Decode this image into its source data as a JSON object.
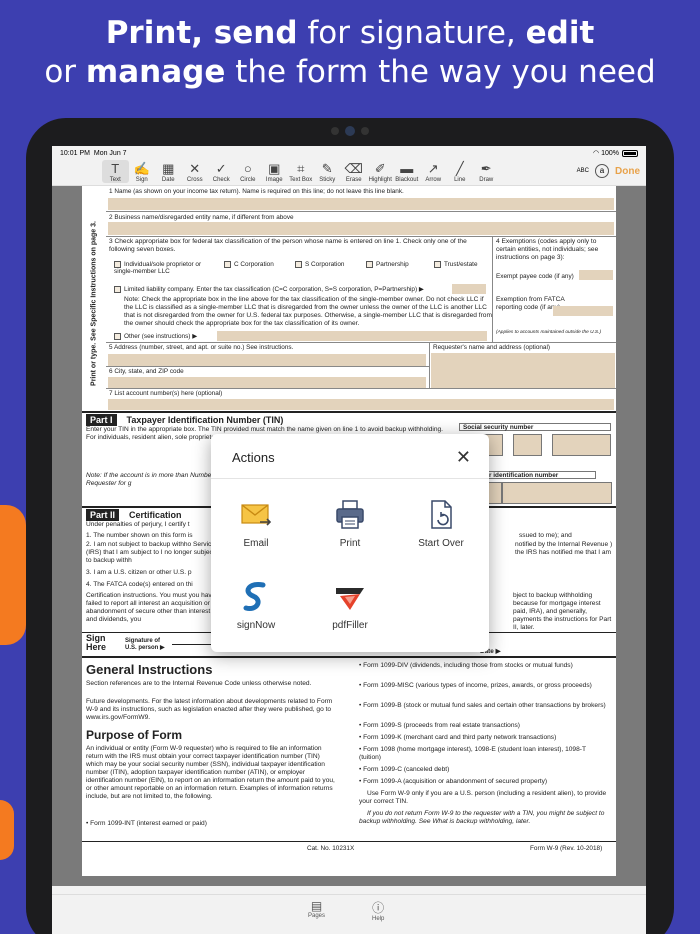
{
  "headline": {
    "line1_bold1": "Print, send",
    "line1_regular": " for signature, ",
    "line1_bold2": "edit",
    "line2_regular1": "or ",
    "line2_bold": "manage",
    "line2_regular2": " the form the way you need"
  },
  "status": {
    "time": "10:01 PM",
    "date": "Mon Jun 7",
    "battery": "100%"
  },
  "toolbar": {
    "tools": [
      {
        "label": "Text",
        "icon": "text-cursor-icon",
        "glyph": "T"
      },
      {
        "label": "Sign",
        "icon": "signature-icon",
        "glyph": "✍"
      },
      {
        "label": "Date",
        "icon": "calendar-icon",
        "glyph": "▦"
      },
      {
        "label": "Cross",
        "icon": "cross-icon",
        "glyph": "✕"
      },
      {
        "label": "Check",
        "icon": "check-icon",
        "glyph": "✓"
      },
      {
        "label": "Circle",
        "icon": "circle-icon",
        "glyph": "○"
      },
      {
        "label": "Image",
        "icon": "image-icon",
        "glyph": "▣"
      },
      {
        "label": "Text Box",
        "icon": "textbox-icon",
        "glyph": "⌗"
      },
      {
        "label": "Sticky",
        "icon": "sticky-note-icon",
        "glyph": "✎"
      },
      {
        "label": "Erase",
        "icon": "eraser-icon",
        "glyph": "⌫"
      },
      {
        "label": "Highlight",
        "icon": "highlighter-icon",
        "glyph": "✐"
      },
      {
        "label": "Blackout",
        "icon": "blackout-icon",
        "glyph": "▬"
      },
      {
        "label": "Arrow",
        "icon": "arrow-icon",
        "glyph": "↗"
      },
      {
        "label": "Line",
        "icon": "line-icon",
        "glyph": "╱"
      },
      {
        "label": "Draw",
        "icon": "pen-icon",
        "glyph": "✒"
      }
    ],
    "abc": "ABC",
    "done": "Done"
  },
  "form": {
    "side_label": "Print or type.   See Specific Instructions on page 3.",
    "line1": "1  Name (as shown on your income tax return). Name is required on this line; do not leave this line blank.",
    "line2": "2  Business name/disregarded entity name, if different from above",
    "line3": "3  Check appropriate box for federal tax classification of the person whose name is entered on line 1. Check only one of the following seven boxes.",
    "opt_individual": "Individual/sole proprietor or single-member LLC",
    "opt_c": "C Corporation",
    "opt_s": "S Corporation",
    "opt_partnership": "Partnership",
    "opt_trust": "Trust/estate",
    "opt_llc": "Limited liability company. Enter the tax classification (C=C corporation, S=S corporation, P=Partnership) ▶",
    "note": "Note: Check the appropriate box in the line above for the tax classification of the single-member owner. Do not check LLC if the LLC is classified as a single-member LLC that is disregarded from the owner unless the owner of the LLC is another LLC that is not disregarded from the owner for U.S. federal tax purposes. Otherwise, a single-member LLC that is disregarded from the owner should check the appropriate box for the tax classification of its owner.",
    "opt_other": "Other (see instructions) ▶",
    "exemptions": "4  Exemptions (codes apply only to certain entities, not individuals; see instructions on page 3):",
    "exempt_payee": "Exempt payee code (if any)",
    "fatca": "Exemption from FATCA reporting code (if any)",
    "applies": "(Applies to accounts maintained outside the U.S.)",
    "line5": "5  Address (number, street, and apt. or suite no.) See instructions.",
    "requester": "Requester's name and address (optional)",
    "line6": "6  City, state, and ZIP code",
    "line7": "7  List account number(s) here (optional)",
    "part1_tag": "Part I",
    "part1_title": "Taxpayer Identification Number (TIN)",
    "part1_text": "Enter your TIN in the appropriate box. The TIN provided must match the name given on line 1 to avoid backup withholding. For individuals, resident alien, sole proprietor, or dis entities, it is your employer identifica TIN, later.",
    "ssn_label": "Social security number",
    "note2": "Note: If the account is in more than Number To Give the Requester for g",
    "ein_label": "r identification number",
    "part2_tag": "Part II",
    "part2_title": "Certification",
    "under_penalties": "Under penalties of perjury, I certify t",
    "cert1": "1. The number shown on this form is",
    "cert2": "2. I am not subject to backup withho Service (IRS) that I am subject to I no longer subject to backup withh",
    "cert3": "3. I am a U.S. citizen or other U.S. p",
    "cert4": "4. The FATCA code(s) entered on thi",
    "cert_instr": "Certification instructions. You must you have failed to report all interest an acquisition or abandonment of secure other than interest and dividends, you",
    "right1": "ssued to me); and",
    "right2": "notified by the Internal Revenue ) the IRS has notified me that I am",
    "right3": "bject to backup withholding because for mortgage interest paid, IRA), and generally, payments the instructions for Part II, later.",
    "sign_here": "Sign Here",
    "signature_of": "Signature of U.S. person ▶",
    "date_lbl": "Date ▶",
    "general_title": "General Instructions",
    "gen_p1": "Section references are to the Internal Revenue Code unless otherwise noted.",
    "gen_p2": "Future developments. For the latest information about developments related to Form W-9 and its instructions, such as legislation enacted after they were published, go to www.irs.gov/FormW9.",
    "purpose_title": "Purpose of Form",
    "purpose_p": "An individual or entity (Form W-9 requester) who is required to file an information return with the IRS must obtain your correct taxpayer identification number (TIN) which may be your social security number (SSN), individual taxpayer identification number (ITIN), adoption taxpayer identification number (ATIN), or employer identification number (EIN), to report on an information return the amount paid to you, or other amount reportable on an information return. Examples of information returns include, but are not limited to, the following.",
    "bullet_int": "• Form 1099-INT (interest earned or paid)",
    "rbul1": "• Form 1099-DIV (dividends, including those from stocks or mutual funds)",
    "rbul2": "• Form 1099-MISC (various types of income, prizes, awards, or gross proceeds)",
    "rbul3": "• Form 1099-B (stock or mutual fund sales and certain other transactions by brokers)",
    "rbul4": "• Form 1099-S (proceeds from real estate transactions)",
    "rbul5": "• Form 1099-K (merchant card and third party network transactions)",
    "rbul6": "• Form 1098 (home mortgage interest), 1098-E (student loan interest), 1098-T (tuition)",
    "rbul7": "• Form 1099-C (canceled debt)",
    "rbul8": "• Form 1099-A (acquisition or abandonment of secured property)",
    "use_w9": "Use Form W-9 only if you are a U.S. person (including a resident alien), to provide your correct TIN.",
    "if_not": "If you do not return Form W-9 to the requester with a TIN, you might be subject to backup withholding. See What is backup withholding, later.",
    "cat_no": "Cat. No. 10231X",
    "form_id": "Form W-9 (Rev. 10-2018)"
  },
  "modal": {
    "title": "Actions",
    "actions": [
      {
        "label": "Email",
        "icon": "email-icon"
      },
      {
        "label": "Print",
        "icon": "printer-icon"
      },
      {
        "label": "Start Over",
        "icon": "start-over-icon"
      },
      {
        "label": "signNow",
        "icon": "signnow-logo-icon"
      },
      {
        "label": "pdfFiller",
        "icon": "pdffiller-logo-icon"
      }
    ]
  },
  "bottombar": {
    "pages": "Pages",
    "help": "Help"
  },
  "colors": {
    "background": "#3d3fb0",
    "accent_orange": "#f47a20",
    "done": "#e8a24a",
    "field_fill": "#e3d3bc"
  }
}
